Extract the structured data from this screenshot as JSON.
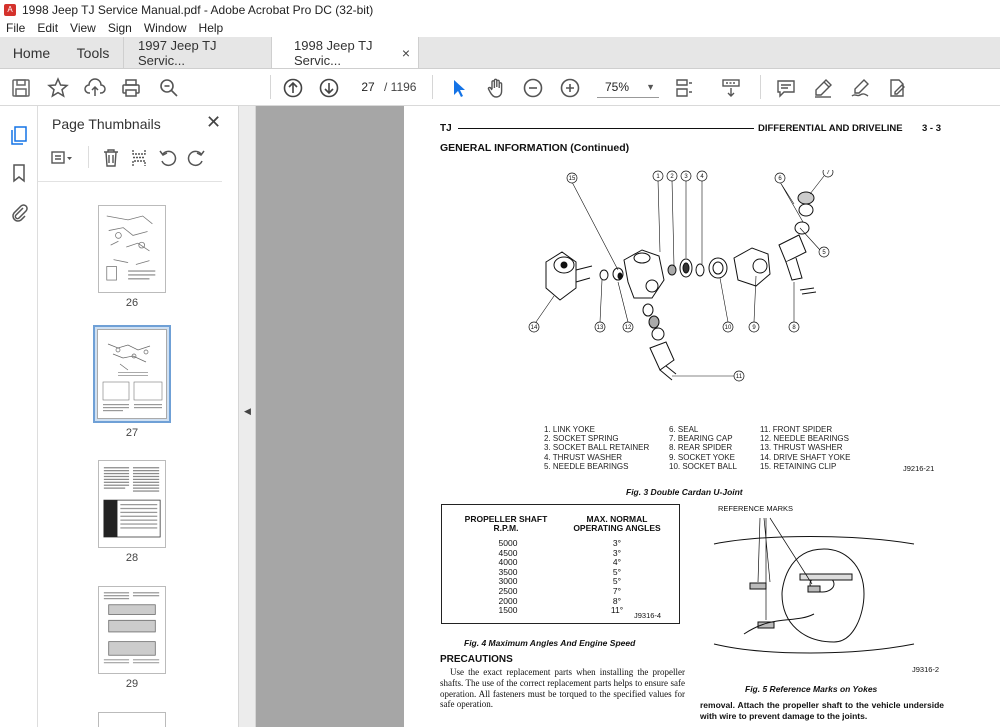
{
  "window": {
    "title": "1998 Jeep TJ Service Manual.pdf - Adobe Acrobat Pro DC (32-bit)",
    "app_icon": "acrobat-icon"
  },
  "menu": [
    "File",
    "Edit",
    "View",
    "Sign",
    "Window",
    "Help"
  ],
  "tabs": {
    "home": "Home",
    "tools": "Tools",
    "doc1": "1997 Jeep TJ Servic...",
    "doc2": "1998 Jeep TJ Servic...",
    "close": "×"
  },
  "toolbar": {
    "page_current": "27",
    "page_total": "/ 1196",
    "zoom": "75%"
  },
  "thumbnails": {
    "heading": "Page Thumbnails",
    "pages": [
      "26",
      "27",
      "28",
      "29"
    ],
    "selected": "27"
  },
  "document": {
    "header_left": "TJ",
    "header_right": "DIFFERENTIAL AND DRIVELINE",
    "header_page": "3 - 3",
    "section_title": "GENERAL INFORMATION (Continued)",
    "fig3_legend_col1": "1. LINK YOKE\n2. SOCKET SPRING\n3. SOCKET BALL RETAINER\n4. THRUST WASHER\n5. NEEDLE BEARINGS",
    "fig3_legend_col2": "6. SEAL\n7. BEARING CAP\n8. REAR SPIDER\n9. SOCKET YOKE\n10. SOCKET BALL",
    "fig3_legend_col3": "11. FRONT SPIDER\n12. NEEDLE BEARINGS\n13. THRUST WASHER\n14. DRIVE SHAFT YOKE\n15. RETAINING CLIP",
    "fig3_code": "J9216-21",
    "fig3_caption": "Fig. 3 Double Cardan U-Joint",
    "fig3_callouts": [
      "1",
      "2",
      "3",
      "4",
      "6",
      "7",
      "5",
      "8",
      "9",
      "10",
      "11",
      "12",
      "13",
      "14",
      "15"
    ],
    "table": {
      "col1_header": "PROPELLER SHAFT\nR.P.M.",
      "col2_header": "MAX. NORMAL\nOPERATING ANGLES",
      "rpm": [
        "5000",
        "4500",
        "4000",
        "3500",
        "3000",
        "2500",
        "2000",
        "1500"
      ],
      "angles": [
        "3°",
        "3°",
        "4°",
        "5°",
        "5°",
        "7°",
        "8°",
        "11°"
      ],
      "code": "J9316-4"
    },
    "fig4_caption": "Fig. 4 Maximum Angles And Engine Speed",
    "precautions_title": "PRECAUTIONS",
    "precautions_text": "Use the exact replacement parts when installing the propeller shafts. The use of the correct replacement parts helps to ensure safe operation. All fasteners must be torqued to the specified values for safe operation.",
    "fig5_label": "REFERENCE MARKS",
    "fig5_code": "J9316-2",
    "fig5_caption": "Fig. 5 Reference Marks on Yokes",
    "right_text": "removal. Attach the propeller shaft to the vehicle underside with wire to prevent damage to the joints."
  },
  "colors": {
    "accent": "#1473e6",
    "tab_bg": "#e6e6e6",
    "viewer_bg": "#a6a6a6",
    "pdf_red": "#d4322c"
  }
}
